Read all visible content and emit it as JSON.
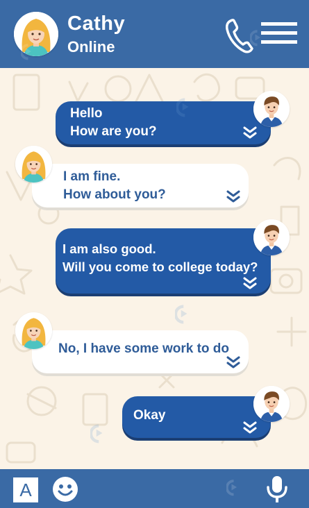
{
  "header": {
    "contact_name": "Cathy",
    "contact_status": "Online",
    "background": "#3a6aa5"
  },
  "messages": [
    {
      "direction": "outgoing",
      "text": "Hello\nHow are you?"
    },
    {
      "direction": "incoming",
      "text": "I am fine.\nHow about you?"
    },
    {
      "direction": "outgoing",
      "text": "I am also good.\nWill you come to college today?"
    },
    {
      "direction": "incoming",
      "text": "No, I have some work to do"
    },
    {
      "direction": "outgoing",
      "text": "Okay"
    }
  ],
  "footer": {
    "keyboard_label": "A"
  },
  "colors": {
    "outgoing_bubble": "#235aa6",
    "incoming_bubble": "#ffffff",
    "incoming_text": "#2f5c98",
    "chat_background": "#fbf3e7"
  },
  "icons": [
    "phone-icon",
    "menu-icon",
    "keyboard-icon",
    "emoji-icon",
    "microphone-icon",
    "chevron-double-down-icon"
  ]
}
